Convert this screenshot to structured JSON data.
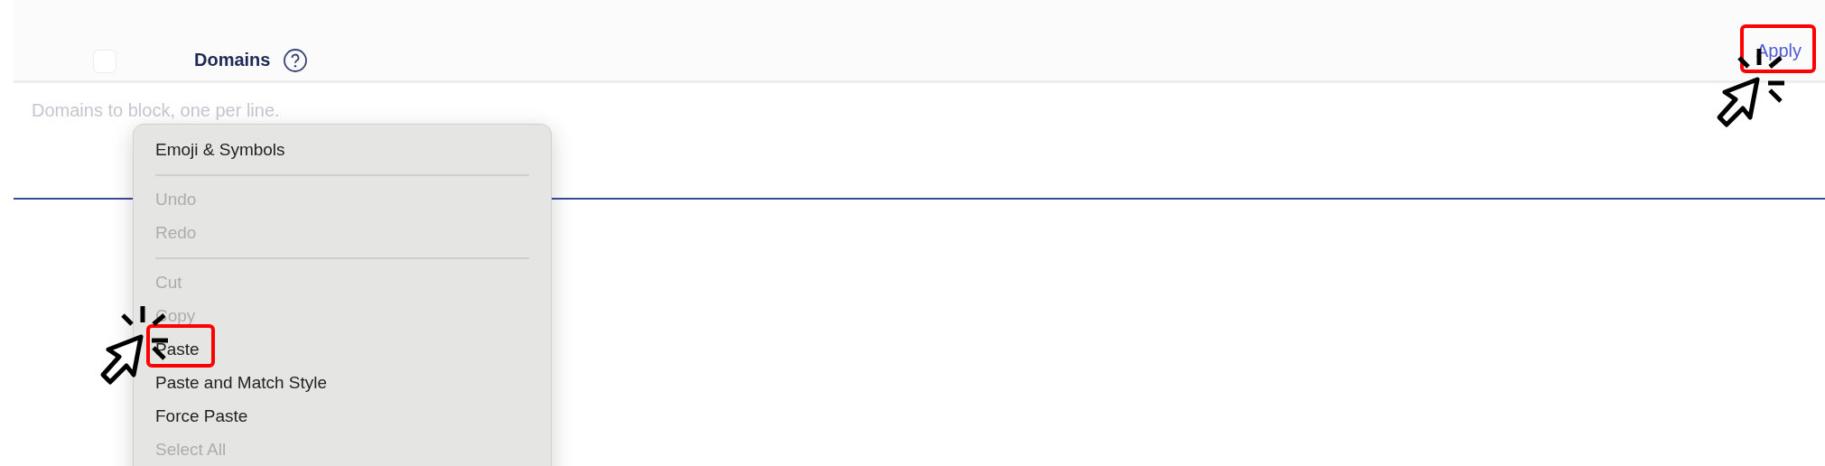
{
  "header": {
    "checkbox": {
      "checked": false
    },
    "title": "Domains",
    "action": {
      "label": "Apply",
      "highlighted": true
    }
  },
  "textarea": {
    "placeholder": "Domains to block, one per line."
  },
  "context_menu": {
    "items": [
      {
        "kind": "item",
        "label": "Emoji & Symbols",
        "disabled": false,
        "highlighted": false
      },
      {
        "kind": "separator"
      },
      {
        "kind": "item",
        "label": "Undo",
        "disabled": true,
        "highlighted": false
      },
      {
        "kind": "item",
        "label": "Redo",
        "disabled": true,
        "highlighted": false
      },
      {
        "kind": "separator"
      },
      {
        "kind": "item",
        "label": "Cut",
        "disabled": true,
        "highlighted": false
      },
      {
        "kind": "item",
        "label": "Copy",
        "disabled": true,
        "highlighted": false
      },
      {
        "kind": "item",
        "label": "Paste",
        "disabled": false,
        "highlighted": true
      },
      {
        "kind": "item",
        "label": "Paste and Match Style",
        "disabled": false,
        "highlighted": false
      },
      {
        "kind": "item",
        "label": "Force Paste",
        "disabled": false,
        "highlighted": false
      },
      {
        "kind": "item",
        "label": "Select All",
        "disabled": true,
        "highlighted": false
      }
    ]
  }
}
